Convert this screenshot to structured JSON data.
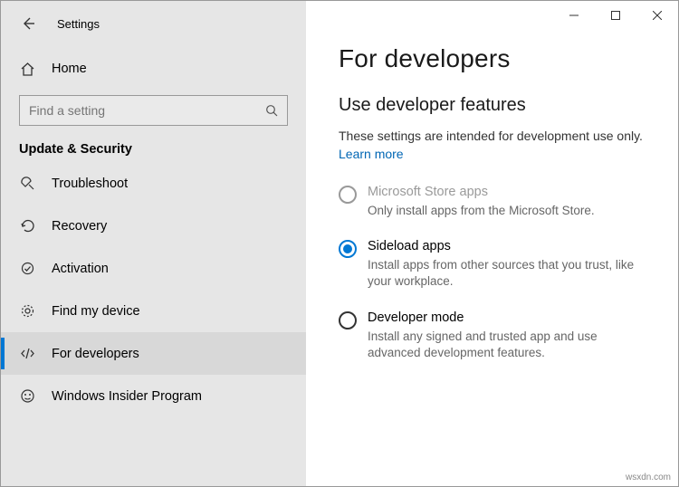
{
  "app_title": "Settings",
  "home_label": "Home",
  "search_placeholder": "Find a setting",
  "section_title": "Update & Security",
  "nav": [
    {
      "label": "Troubleshoot",
      "icon": "troubleshoot"
    },
    {
      "label": "Recovery",
      "icon": "recovery"
    },
    {
      "label": "Activation",
      "icon": "activation"
    },
    {
      "label": "Find my device",
      "icon": "find"
    },
    {
      "label": "For developers",
      "icon": "dev"
    },
    {
      "label": "Windows Insider Program",
      "icon": "insider"
    }
  ],
  "main": {
    "title": "For developers",
    "subheading": "Use developer features",
    "desc": "These settings are intended for development use only.",
    "learn_more": "Learn more",
    "options": [
      {
        "title": "Microsoft Store apps",
        "desc": "Only install apps from the Microsoft Store."
      },
      {
        "title": "Sideload apps",
        "desc": "Install apps from other sources that you trust, like your workplace."
      },
      {
        "title": "Developer mode",
        "desc": "Install any signed and trusted app and use advanced development features."
      }
    ]
  },
  "watermark": "wsxdn.com"
}
